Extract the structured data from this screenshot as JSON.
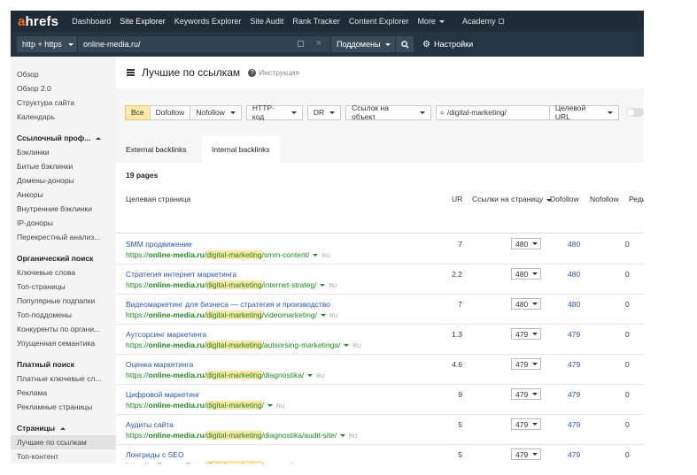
{
  "brand": {
    "logo_prefix": "a",
    "logo_rest": "hrefs"
  },
  "topnav": {
    "items": [
      {
        "label": "Dashboard",
        "active": false
      },
      {
        "label": "Site Explorer",
        "active": true
      },
      {
        "label": "Keywords Explorer",
        "active": false
      },
      {
        "label": "Site Audit",
        "active": false
      },
      {
        "label": "Rank Tracker",
        "active": false
      },
      {
        "label": "Content Explorer",
        "active": false
      }
    ],
    "more_label": "More",
    "academy_label": "Academy"
  },
  "searchbar": {
    "protocol": "http + https",
    "target": "online-media.ru/",
    "mode": "Поддомены",
    "settings_label": "Настройки"
  },
  "sidebar": {
    "top_items": [
      "Обзор",
      "Обзор 2.0",
      "Структура сайта",
      "Календарь"
    ],
    "sections": [
      {
        "title": "Ссылочный проф...",
        "items": [
          "Бэклинки",
          "Битые бэклинки",
          "Домены-доноры",
          "Анкоры",
          "Внутренние бэклинки",
          "IP-доноры",
          "Перекрестный анализ..."
        ]
      },
      {
        "title": "Органический поиск",
        "items": [
          "Ключевые слова",
          "Топ-страницы",
          "Популярные подпапки",
          "Топ-поддомены",
          "Конкуренты по органи...",
          "Упущенная семантика"
        ]
      },
      {
        "title": "Платный поиск",
        "items": [
          "Платные ключевые сл...",
          "Реклама",
          "Рекламные страницы"
        ]
      },
      {
        "title": "Страницы",
        "items": [
          "Лучшие по ссылкам",
          "Топ-контент"
        ]
      }
    ],
    "active_item": "Лучшие по ссылкам"
  },
  "page": {
    "title": "Лучшие по ссылкам",
    "help_glyph": "?",
    "howto": "Инструкция"
  },
  "filters": {
    "all": "Все",
    "dofollow": "Dofollow",
    "nofollow": "Nofollow",
    "http_code": "HTTP-код",
    "dr": "DR",
    "links_to": "Ссылок на объект",
    "search_value": "/digital-marketing/",
    "target_url": "Целевой URL"
  },
  "tabs": [
    {
      "label": "External backlinks",
      "active": false
    },
    {
      "label": "Internal backlinks",
      "active": true
    }
  ],
  "summary": {
    "pages": "19 pages"
  },
  "table": {
    "columns": {
      "target_page": "Целевая страница",
      "ur": "UR",
      "links_to_page": "Ссылки на страницу",
      "dofollow": "Dofollow",
      "nofollow": "Nofollow",
      "more": "Реди"
    },
    "url_prefix": "https://",
    "url_domain": "online-media.ru",
    "url_slash": "/",
    "url_folder": "digital-marketing",
    "lang": "RU",
    "rows": [
      {
        "title": "SMM продвижение",
        "path": "/smm-content/",
        "ur": "7",
        "links": "480",
        "dofollow": "480",
        "nofollow": "0"
      },
      {
        "title": "Стратегия интернет маркетинга",
        "path": "/internet-strateg/",
        "ur": "2.2",
        "links": "480",
        "dofollow": "480",
        "nofollow": "0"
      },
      {
        "title": "Видеомаркетинг для бизнеса — стратегия и производство",
        "path": "/videomarketing/",
        "ur": "7",
        "links": "480",
        "dofollow": "480",
        "nofollow": "0"
      },
      {
        "title": "Аутсорсинг маркетинга",
        "path": "/autsorsing-marketinga/",
        "ur": "1.3",
        "links": "479",
        "dofollow": "479",
        "nofollow": "0"
      },
      {
        "title": "Оценка маркетинга",
        "path": "/diagnostika/",
        "ur": "4.6",
        "links": "479",
        "dofollow": "479",
        "nofollow": "0"
      },
      {
        "title": "Цифровой маркетинг",
        "path": "/",
        "ur": "9",
        "links": "479",
        "dofollow": "479",
        "nofollow": "0"
      },
      {
        "title": "Аудиты сайта",
        "path": "/diagnostika/audit-site/",
        "ur": "5",
        "links": "479",
        "dofollow": "479",
        "nofollow": "0"
      },
      {
        "title": "Лонгриды с SEO",
        "path": "/seo-text/",
        "ur": "5",
        "links": "479",
        "dofollow": "479",
        "nofollow": "0"
      }
    ]
  },
  "colors": {
    "nav_bg": "#1f2b36",
    "logo_accent": "#f4711f",
    "link_blue": "#2a55b9",
    "url_green": "#1f8a1f",
    "highlight": "#fbe6a9",
    "all_button": "#ffe9a8"
  }
}
